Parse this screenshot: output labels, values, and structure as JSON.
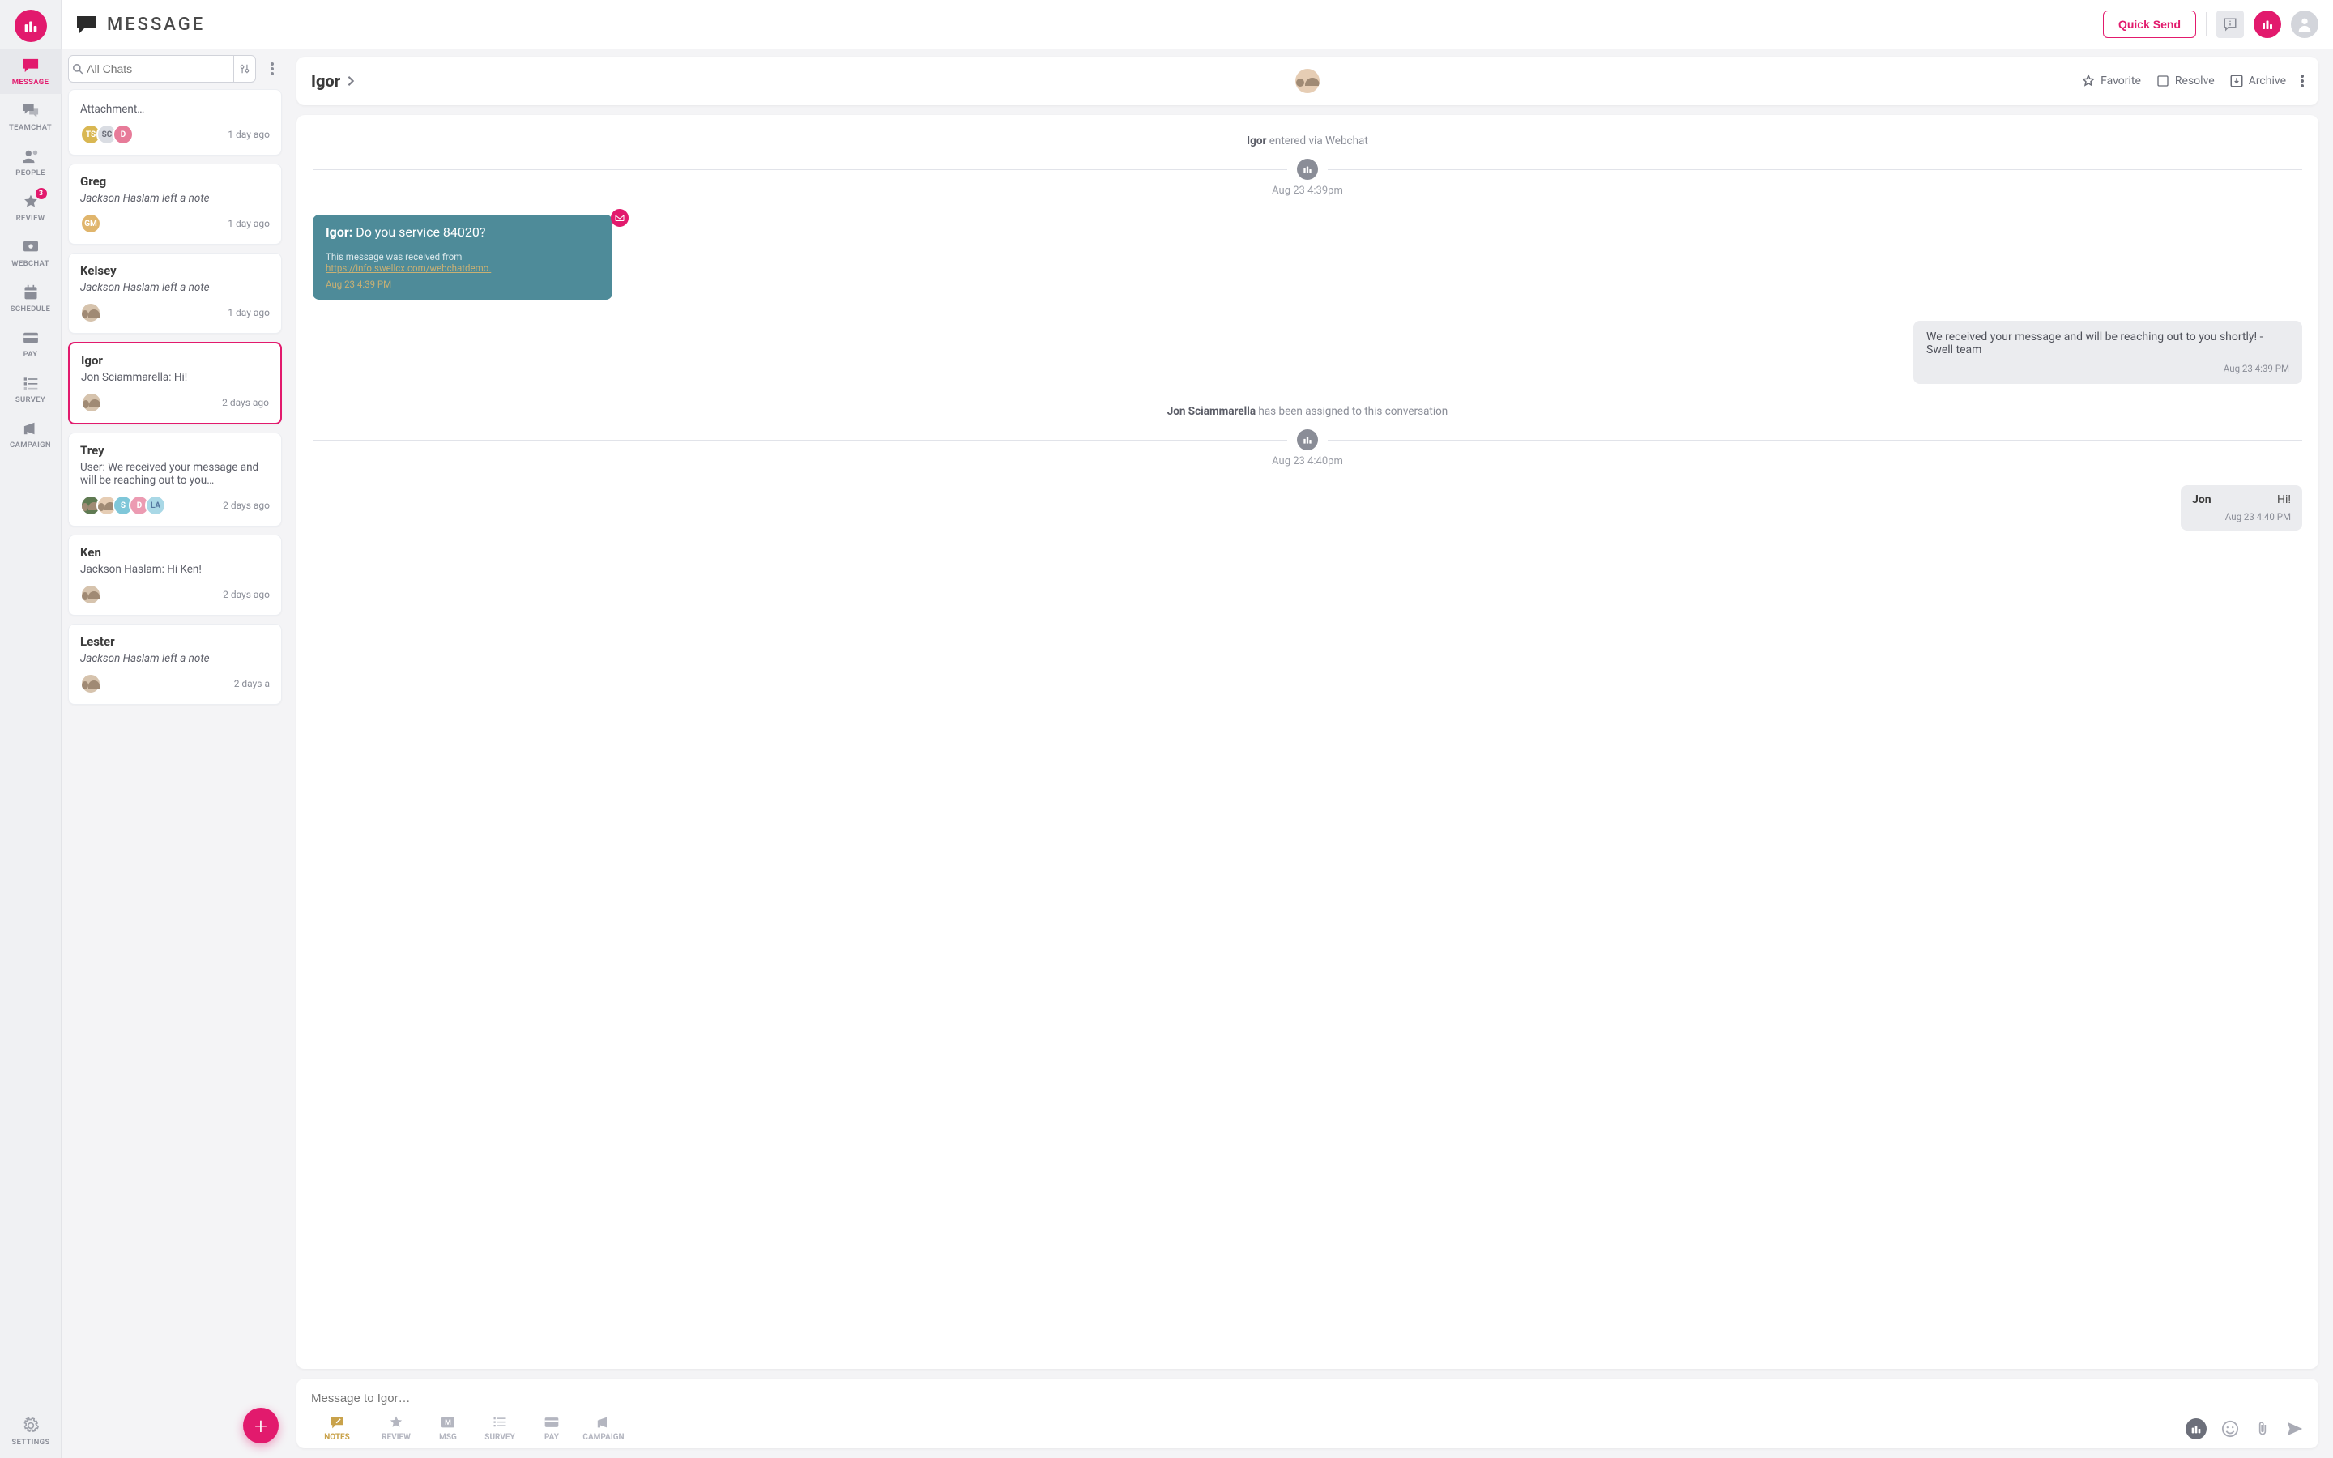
{
  "app": {
    "title": "MESSAGE",
    "quick_send": "Quick Send"
  },
  "nav": {
    "items": [
      {
        "label": "MESSAGE",
        "badge": null
      },
      {
        "label": "TEAMCHAT",
        "badge": null
      },
      {
        "label": "PEOPLE",
        "badge": null
      },
      {
        "label": "REVIEW",
        "badge": "3"
      },
      {
        "label": "WEBCHAT",
        "badge": null
      },
      {
        "label": "SCHEDULE",
        "badge": null
      },
      {
        "label": "PAY",
        "badge": null
      },
      {
        "label": "SURVEY",
        "badge": null
      },
      {
        "label": "CAMPAIGN",
        "badge": null
      }
    ],
    "settings": "SETTINGS"
  },
  "search": {
    "placeholder": "All Chats"
  },
  "conversations": [
    {
      "name": "",
      "preview": "Attachment…",
      "italic": false,
      "time": "1 day ago",
      "avatars": [
        {
          "text": "TS",
          "bg": "#d9b752"
        },
        {
          "text": "SC",
          "bg": "#dadde3",
          "fg": "#6b6e78"
        },
        {
          "text": "D",
          "bg": "#e77b99"
        }
      ]
    },
    {
      "name": "Greg",
      "preview": "Jackson Haslam left a note",
      "italic": true,
      "time": "1 day ago",
      "avatars": [
        {
          "text": "GM",
          "bg": "#e0b56c"
        }
      ]
    },
    {
      "name": "Kelsey",
      "preview": "Jackson Haslam left a note",
      "italic": true,
      "time": "1 day ago",
      "avatars": [
        {
          "text": "",
          "bg": "#d6c3ad",
          "img": true
        }
      ]
    },
    {
      "name": "Igor",
      "preview": "Jon Sciammarella: Hi!",
      "italic": false,
      "time": "2 days ago",
      "selected": true,
      "avatars": [
        {
          "text": "",
          "bg": "#d6c3ad",
          "img": true
        }
      ]
    },
    {
      "name": "Trey",
      "preview": "User: We received your message and will be reaching out to you…",
      "italic": false,
      "time": "2 days ago",
      "avatars": [
        {
          "text": "",
          "bg": "#5f7a52",
          "img": true
        },
        {
          "text": "",
          "bg": "#e6cdb4",
          "img": true
        },
        {
          "text": "S",
          "bg": "#7fc7d9"
        },
        {
          "text": "D",
          "bg": "#ec9bb2"
        },
        {
          "text": "LA",
          "bg": "#a9d8e6",
          "fg": "#5478a0"
        }
      ]
    },
    {
      "name": "Ken",
      "preview": "Jackson Haslam: Hi Ken!",
      "italic": false,
      "time": "2 days ago",
      "avatars": [
        {
          "text": "",
          "bg": "#d6c3ad",
          "img": true
        }
      ]
    },
    {
      "name": "Lester",
      "preview": "Jackson Haslam left a note",
      "italic": true,
      "time": "2 days a",
      "avatars": [
        {
          "text": "",
          "bg": "#d6c3ad",
          "img": true
        }
      ]
    }
  ],
  "thread": {
    "name": "Igor",
    "actions": {
      "favorite": "Favorite",
      "resolve": "Resolve",
      "archive": "Archive"
    },
    "events": {
      "entered_prefix": "Igor",
      "entered_suffix": " entered via Webchat",
      "entered_time": "Aug 23 4:39pm",
      "assigned_prefix": "Jon Sciammarella",
      "assigned_suffix": " has been assigned to this conversation",
      "assigned_time": "Aug 23 4:40pm"
    },
    "msg_in": {
      "from": "Igor:",
      "body": " Do you service 84020?",
      "meta_prefix": "This message was received from ",
      "meta_link": "https://info.swellcx.com/webchatdemo.",
      "ts": "Aug 23 4:39 PM"
    },
    "msg_out": {
      "body": "We received your message and will be reaching out to you shortly! - Swell team",
      "ts": "Aug 23 4:39 PM"
    },
    "msg_jon": {
      "name": "Jon",
      "body": "Hi!",
      "ts": "Aug 23 4:40 PM"
    }
  },
  "composer": {
    "placeholder": "Message to Igor…",
    "tabs": {
      "notes": "NOTES",
      "review": "REVIEW",
      "msg": "MSG",
      "survey": "SURVEY",
      "pay": "PAY",
      "campaign": "CAMPAIGN"
    }
  }
}
